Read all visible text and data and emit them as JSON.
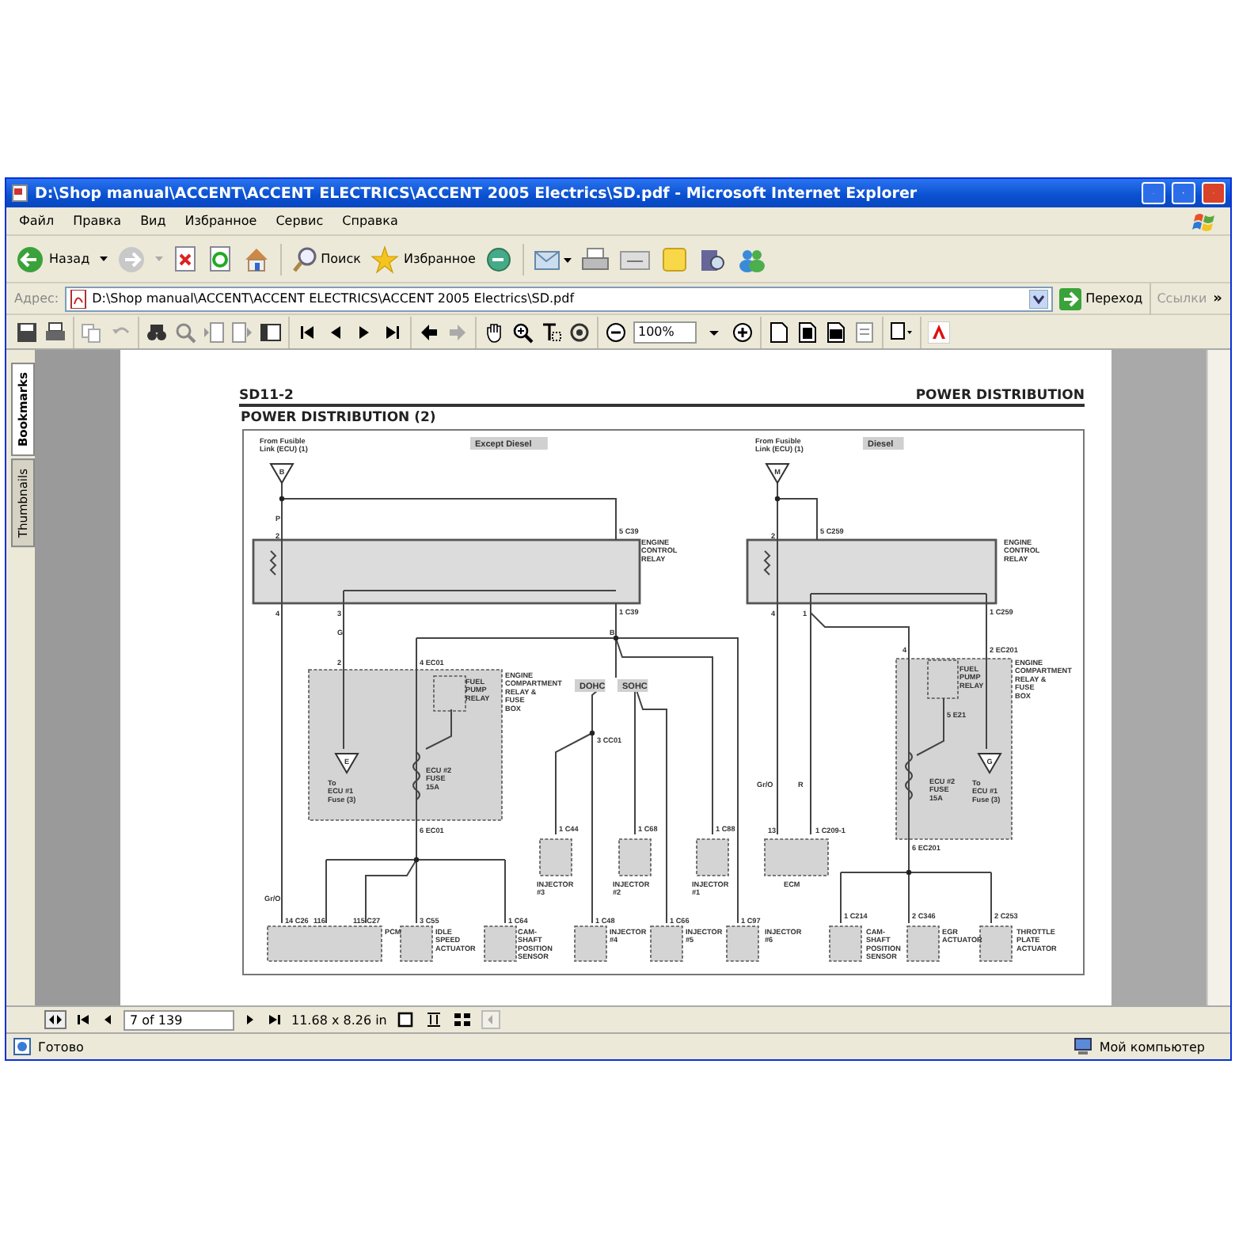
{
  "window": {
    "title": "D:\\Shop manual\\ACCENT\\ACCENT ELECTRICS\\ACCENT 2005 Electrics\\SD.pdf - Microsoft Internet Explorer"
  },
  "menu": [
    "Файл",
    "Правка",
    "Вид",
    "Избранное",
    "Сервис",
    "Справка"
  ],
  "toolbar": {
    "back": "Назад",
    "search": "Поиск",
    "favorites": "Избранное"
  },
  "address": {
    "label": "Адрес:",
    "value": "D:\\Shop manual\\ACCENT\\ACCENT ELECTRICS\\ACCENT 2005 Electrics\\SD.pdf",
    "go": "Переход",
    "links": "Ссылки",
    "more": "»"
  },
  "pdf_toolbar": {
    "zoom": "100%"
  },
  "side_tabs": [
    {
      "label": "Bookmarks",
      "selected": true
    },
    {
      "label": "Thumbnails",
      "selected": false
    }
  ],
  "page": {
    "code": "SD11-2",
    "section": "POWER DISTRIBUTION",
    "title": "POWER DISTRIBUTION (2)",
    "panels": [
      {
        "labels": [
          {
            "kind": "label",
            "text": "From Fusible\nLink (ECU) (1)"
          },
          {
            "kind": "tag",
            "text": "Except Diesel"
          },
          {
            "kind": "terminal",
            "text": "B"
          },
          {
            "kind": "label",
            "text": "P"
          },
          {
            "kind": "label",
            "text": "2"
          },
          {
            "kind": "label",
            "text": "5 C39"
          },
          {
            "kind": "label",
            "text": "ENGINE\nCONTROL\nRELAY"
          },
          {
            "kind": "label",
            "text": "4"
          },
          {
            "kind": "label",
            "text": "3"
          },
          {
            "kind": "label",
            "text": "1 C39"
          },
          {
            "kind": "label",
            "text": "G"
          },
          {
            "kind": "label",
            "text": "B"
          },
          {
            "kind": "label",
            "text": "2"
          },
          {
            "kind": "label",
            "text": "4 EC01"
          },
          {
            "kind": "label",
            "text": "FUEL\nPUMP\nRELAY"
          },
          {
            "kind": "label",
            "text": "ENGINE\nCOMPARTMENT\nRELAY &\nFUSE\nBOX"
          },
          {
            "kind": "tag",
            "text": "DOHC"
          },
          {
            "kind": "tag",
            "text": "SOHC"
          },
          {
            "kind": "label",
            "text": "3 CC01"
          },
          {
            "kind": "terminal",
            "text": "E"
          },
          {
            "kind": "label",
            "text": "To\nECU #1\nFuse (3)"
          },
          {
            "kind": "label",
            "text": "ECU #2\nFUSE\n15A"
          },
          {
            "kind": "label",
            "text": "6 EC01"
          },
          {
            "kind": "label",
            "text": "1 C44"
          },
          {
            "kind": "label",
            "text": "1 C68"
          },
          {
            "kind": "label",
            "text": "1 C88"
          },
          {
            "kind": "label",
            "text": "INJECTOR\n#3"
          },
          {
            "kind": "label",
            "text": "INJECTOR\n#2"
          },
          {
            "kind": "label",
            "text": "INJECTOR\n#1"
          },
          {
            "kind": "label",
            "text": "Gr/O"
          },
          {
            "kind": "label",
            "text": "14 C26"
          },
          {
            "kind": "label",
            "text": "116"
          },
          {
            "kind": "label",
            "text": "115 C27"
          },
          {
            "kind": "label",
            "text": "PCM"
          },
          {
            "kind": "label",
            "text": "3 C55"
          },
          {
            "kind": "label",
            "text": "IDLE\nSPEED\nACTUATOR"
          },
          {
            "kind": "label",
            "text": "1 C64"
          },
          {
            "kind": "label",
            "text": "CAM-\nSHAFT\nPOSITION\nSENSOR"
          },
          {
            "kind": "label",
            "text": "1 C48"
          },
          {
            "kind": "label",
            "text": "INJECTOR\n#4"
          },
          {
            "kind": "label",
            "text": "1 C66"
          },
          {
            "kind": "label",
            "text": "INJECTOR\n#5"
          },
          {
            "kind": "label",
            "text": "1 C97"
          },
          {
            "kind": "label",
            "text": "INJECTOR\n#6"
          }
        ]
      },
      {
        "labels": [
          {
            "kind": "label",
            "text": "From Fusible\nLink (ECU) (1)"
          },
          {
            "kind": "tag",
            "text": "Diesel"
          },
          {
            "kind": "terminal",
            "text": "M"
          },
          {
            "kind": "label",
            "text": "2"
          },
          {
            "kind": "label",
            "text": "5 C259"
          },
          {
            "kind": "label",
            "text": "ENGINE\nCONTROL\nRELAY"
          },
          {
            "kind": "label",
            "text": "4"
          },
          {
            "kind": "label",
            "text": "1"
          },
          {
            "kind": "label",
            "text": "1 C259"
          },
          {
            "kind": "label",
            "text": "2 EC201"
          },
          {
            "kind": "label",
            "text": "4"
          },
          {
            "kind": "label",
            "text": "FUEL\nPUMP\nRELAY"
          },
          {
            "kind": "label",
            "text": "ENGINE\nCOMPARTMENT\nRELAY &\nFUSE\nBOX"
          },
          {
            "kind": "label",
            "text": "5 E21"
          },
          {
            "kind": "terminal",
            "text": "G"
          },
          {
            "kind": "label",
            "text": "Gr/O"
          },
          {
            "kind": "label",
            "text": "R"
          },
          {
            "kind": "label",
            "text": "ECU #2\nFUSE\n15A"
          },
          {
            "kind": "label",
            "text": "To\nECU #1\nFuse (3)"
          },
          {
            "kind": "label",
            "text": "13"
          },
          {
            "kind": "label",
            "text": "1 C209-1"
          },
          {
            "kind": "label",
            "text": "ECM"
          },
          {
            "kind": "label",
            "text": "6 EC201"
          },
          {
            "kind": "label",
            "text": "1 C214"
          },
          {
            "kind": "label",
            "text": "CAM-\nSHAFT\nPOSITION\nSENSOR"
          },
          {
            "kind": "label",
            "text": "2 C346"
          },
          {
            "kind": "label",
            "text": "EGR\nACTUATOR"
          },
          {
            "kind": "label",
            "text": "2 C253"
          },
          {
            "kind": "label",
            "text": "THROTTLE\nPLATE\nACTUATOR"
          }
        ]
      }
    ]
  },
  "nav": {
    "page": "7 of 139",
    "size": "11.68 x 8.26 in"
  },
  "status_bar": {
    "text": "Готово",
    "zone": "Мой компьютер"
  }
}
